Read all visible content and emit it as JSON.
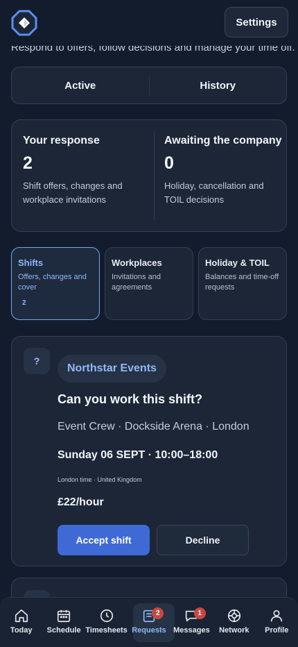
{
  "header": {
    "settings_label": "Settings",
    "subtitle": "Respond to offers, follow decisions and manage your time off."
  },
  "segments": [
    {
      "label": "Active",
      "selected": true
    },
    {
      "label": "History",
      "selected": false
    }
  ],
  "summary": {
    "response": {
      "title": "Your response",
      "count": "2",
      "desc": "Shift offers, changes and workplace invitations"
    },
    "awaiting": {
      "title": "Awaiting the company",
      "count": "0",
      "desc": "Holiday, cancellation and TOIL decisions"
    }
  },
  "categories": [
    {
      "title": "Shifts",
      "desc": "Offers, changes and cover",
      "count": "2",
      "active": true
    },
    {
      "title": "Workplaces",
      "desc": "Invitations and agreements"
    },
    {
      "title": "Holiday & TOIL",
      "desc": "Balances and time-off requests"
    }
  ],
  "offer": {
    "badge": "?",
    "company": "Northstar Events",
    "question": "Can you work this shift?",
    "location": "Event Crew · Dockside Arena · London",
    "datetime": "Sunday 06 SEPT · 10:00–18:00",
    "timezone": "London time · United Kingdom",
    "rate": "£22/hour",
    "accept_label": "Accept shift",
    "decline_label": "Decline"
  },
  "nav": {
    "items": [
      {
        "label": "Today",
        "icon": "home-icon"
      },
      {
        "label": "Schedule",
        "icon": "calendar-icon"
      },
      {
        "label": "Timesheets",
        "icon": "clock-icon"
      },
      {
        "label": "Requests",
        "icon": "inbox-icon",
        "badge": "2",
        "active": true
      },
      {
        "label": "Messages",
        "icon": "chat-icon",
        "badge": "1"
      },
      {
        "label": "Network",
        "icon": "network-icon"
      },
      {
        "label": "Profile",
        "icon": "user-icon"
      }
    ]
  },
  "colors": {
    "background": "#131c2c",
    "card": "#1c2637",
    "accent": "#3f6ad6",
    "accent_text": "#8fb9f5",
    "badge": "#c9473f"
  }
}
